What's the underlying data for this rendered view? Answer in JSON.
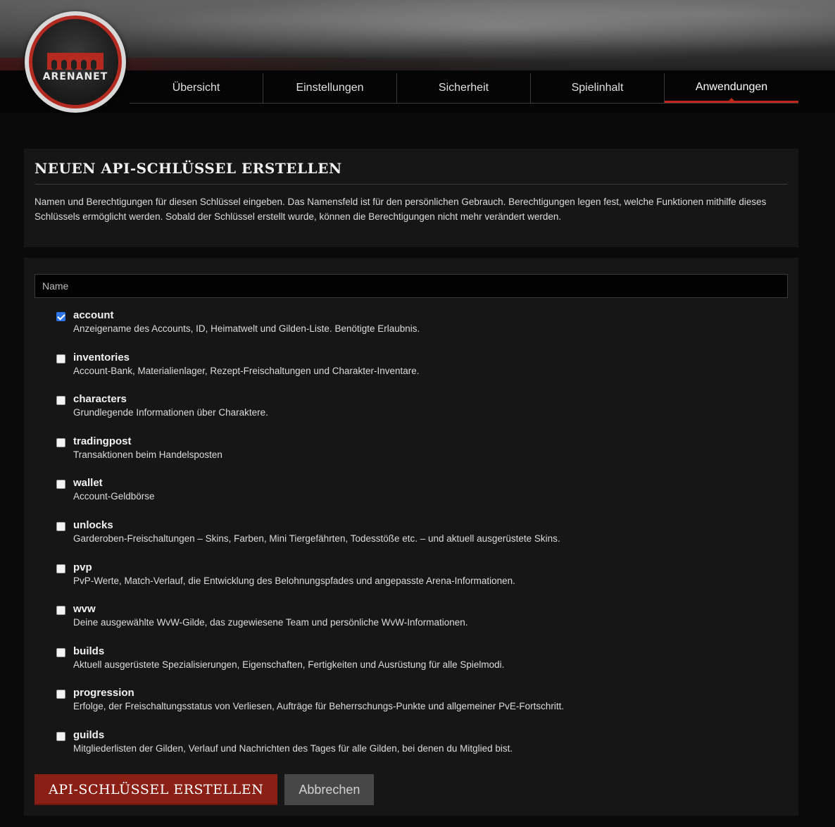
{
  "brand": {
    "logo_text": "ARENANET",
    "accent": "#c0281d"
  },
  "nav": {
    "items": [
      {
        "label": "Übersicht",
        "active": false
      },
      {
        "label": "Einstellungen",
        "active": false
      },
      {
        "label": "Sicherheit",
        "active": false
      },
      {
        "label": "Spielinhalt",
        "active": false
      },
      {
        "label": "Anwendungen",
        "active": true
      }
    ]
  },
  "intro": {
    "title": "NEUEN API-SCHLÜSSEL ERSTELLEN",
    "description": "Namen und Berechtigungen für diesen Schlüssel eingeben. Das Namensfeld ist für den persönlichen Gebrauch. Berechtigungen legen fest, welche Funktionen mithilfe dieses Schlüssels ermöglicht werden. Sobald der Schlüssel erstellt wurde, können die Berechtigungen nicht mehr verändert werden."
  },
  "form": {
    "name_placeholder": "Name",
    "name_value": "",
    "permissions": [
      {
        "name": "account",
        "description": "Anzeigename des Accounts, ID, Heimatwelt und Gilden-Liste. Benötigte Erlaubnis.",
        "checked": true
      },
      {
        "name": "inventories",
        "description": "Account-Bank, Materialienlager, Rezept-Freischaltungen und Charakter-Inventare.",
        "checked": false
      },
      {
        "name": "characters",
        "description": "Grundlegende Informationen über Charaktere.",
        "checked": false
      },
      {
        "name": "tradingpost",
        "description": "Transaktionen beim Handelsposten",
        "checked": false
      },
      {
        "name": "wallet",
        "description": "Account-Geldbörse",
        "checked": false
      },
      {
        "name": "unlocks",
        "description": "Garderoben-Freischaltungen – Skins, Farben, Mini Tiergefährten, Todesstöße etc. – und aktuell ausgerüstete Skins.",
        "checked": false
      },
      {
        "name": "pvp",
        "description": "PvP-Werte, Match-Verlauf, die Entwicklung des Belohnungspfades und angepasste Arena-Informationen.",
        "checked": false
      },
      {
        "name": "wvw",
        "description": "Deine ausgewählte WvW-Gilde, das zugewiesene Team und persönliche WvW-Informationen.",
        "checked": false
      },
      {
        "name": "builds",
        "description": "Aktuell ausgerüstete Spezialisierungen, Eigenschaften, Fertigkeiten und Ausrüstung für alle Spielmodi.",
        "checked": false
      },
      {
        "name": "progression",
        "description": "Erfolge, der Freischaltungsstatus von Verliesen, Aufträge für Beherrschungs-Punkte und allgemeiner PvE-Fortschritt.",
        "checked": false
      },
      {
        "name": "guilds",
        "description": "Mitgliederlisten der Gilden, Verlauf und Nachrichten des Tages für alle Gilden, bei denen du Mitglied bist.",
        "checked": false
      }
    ],
    "submit_label": "API-SCHLÜSSEL ERSTELLEN",
    "cancel_label": "Abbrechen"
  }
}
